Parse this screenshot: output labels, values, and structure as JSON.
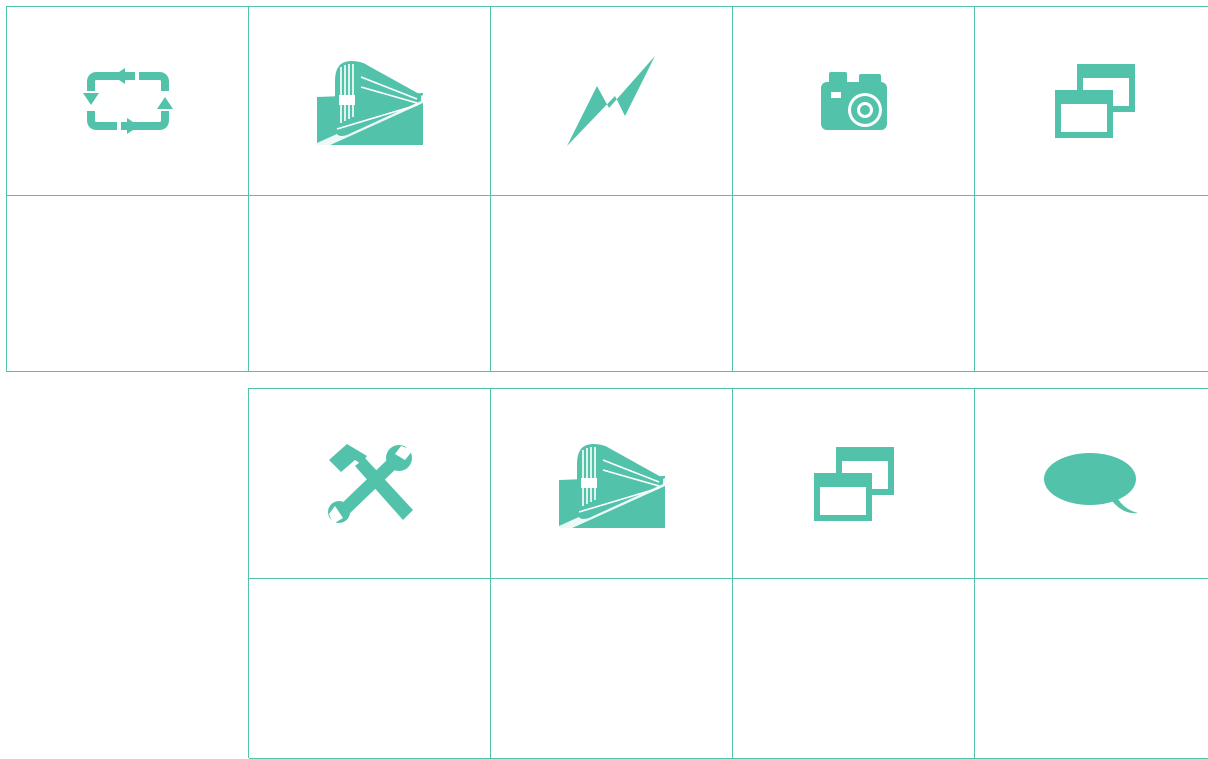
{
  "theme": {
    "accent": "#52c2ab"
  },
  "grid_top": {
    "icons": [
      "repeat-icon",
      "train-icon",
      "lightning-icon",
      "camera-icon",
      "windows-icon"
    ]
  },
  "grid_bottom": {
    "icons": [
      "tools-icon",
      "train-icon",
      "windows-icon",
      "speech-bubble-icon"
    ]
  }
}
